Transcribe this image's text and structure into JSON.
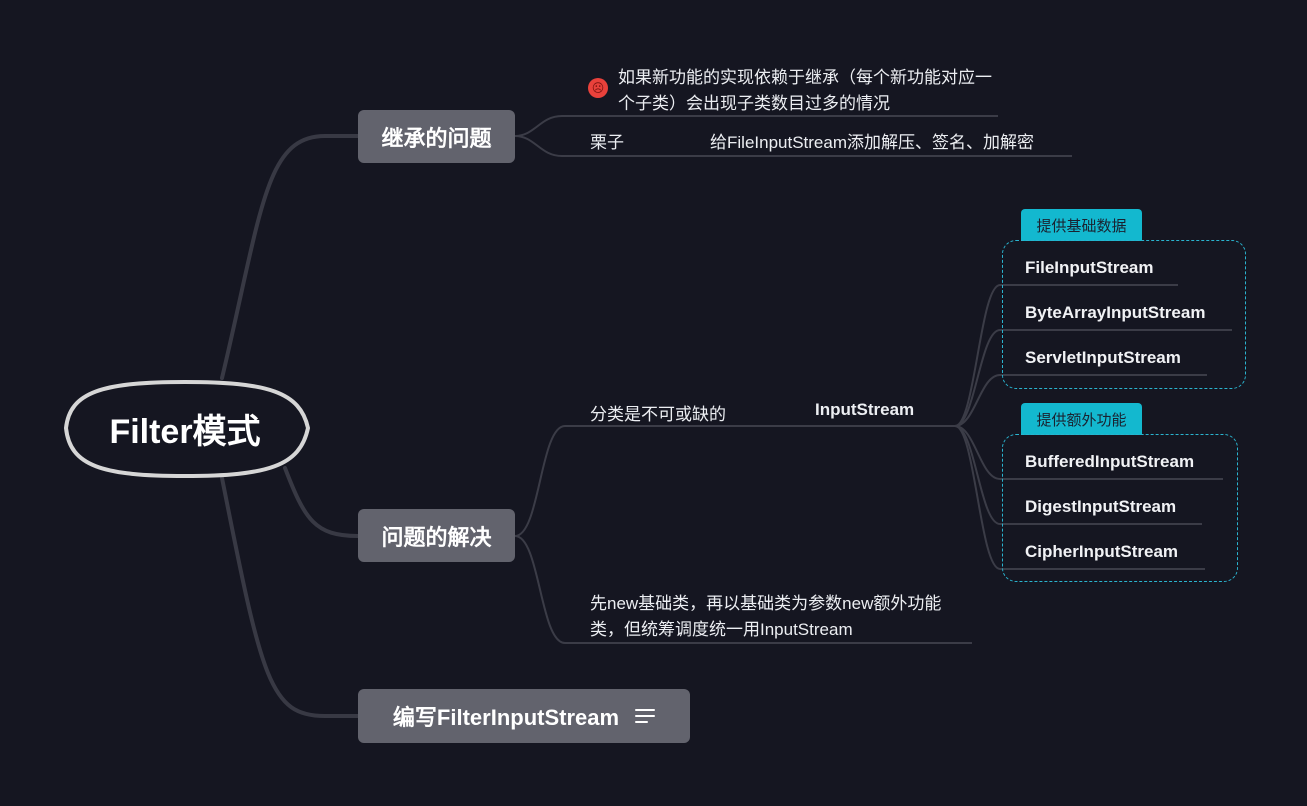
{
  "root": {
    "title": "Filter模式"
  },
  "topics": {
    "inheritance": {
      "label": "继承的问题",
      "problem": "如果新功能的实现依赖于继承（每个新功能对应一个子类）会出现子类数目过多的情况",
      "example_label": "栗子",
      "example_value": "给FileInputStream添加解压、签名、加解密"
    },
    "solution": {
      "label": "问题的解决",
      "classification": "分类是不可或缺的",
      "base": "InputStream",
      "groups": [
        {
          "label": "提供基础数据",
          "items": [
            "FileInputStream",
            "ByteArrayInputStream",
            "ServletInputStream"
          ]
        },
        {
          "label": "提供额外功能",
          "items": [
            "BufferedInputStream",
            "DigestInputStream",
            "CipherInputStream"
          ]
        }
      ],
      "usage": "先new基础类，再以基础类为参数new额外功能类，但统筹调度统一用InputStream"
    },
    "write": {
      "label": "编写FilterInputStream",
      "note_icon": "notes-icon"
    }
  },
  "colors": {
    "background": "#151621",
    "topic": "#62636d",
    "accent": "#13b8cf",
    "line": "#3a3b46",
    "emoji": "#e9413b"
  }
}
